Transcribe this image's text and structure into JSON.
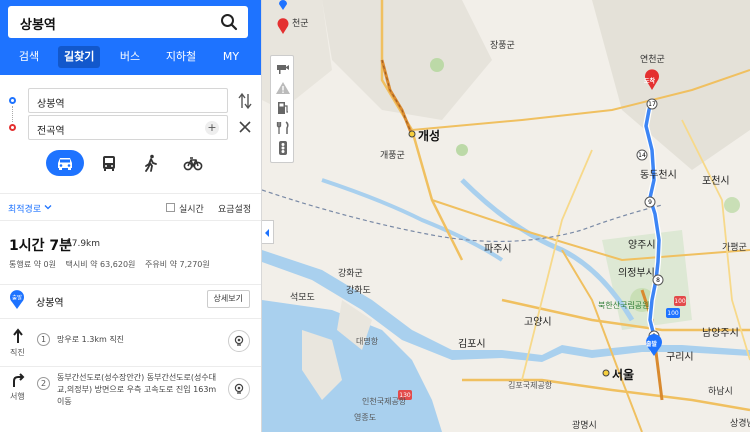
{
  "search": {
    "query": "상봉역"
  },
  "tabs": [
    "검색",
    "길찾기",
    "버스",
    "지하철",
    "MY"
  ],
  "route": {
    "start": "상봉역",
    "end": "전곡역"
  },
  "options": {
    "sort_label": "최적경로",
    "realtime_label": "실시간",
    "fee_setting_label": "요금설정"
  },
  "summary": {
    "time": "1시간 7분",
    "distance": "57.9km",
    "toll": "통행료 약 0원",
    "taxi": "택시비 약 63,620원",
    "fuel": "주유비 약 7,270원"
  },
  "steps": {
    "start_badge": "출발",
    "start_name": "상봉역",
    "detail_button": "상세보기",
    "s1_dir": "직진",
    "s1_num": "1",
    "s1_text": "망우로 1.3km 직진",
    "s2_dir": "서행",
    "s2_num": "2",
    "s2_text": "동부간선도로(성수장안간) 동부간선도로(성수대교,의정부) 방면으로 우측 고속도로 진입 163m 이동"
  },
  "map": {
    "labels": {
      "cheongun": "천군",
      "jangpung": "장풍군",
      "yeoncheon": "연천군",
      "gaeseong": "개성",
      "gaepung": "개풍군",
      "dongducheon": "동두천시",
      "pocheon": "포천시",
      "paju": "파주시",
      "yangju": "양주시",
      "gapyeong": "가평군",
      "gangwha": "강화군",
      "gangwhado": "강화도",
      "uijeongbu": "의정부시",
      "seokmodo": "석모도",
      "bukhansan": "북한산국립공원",
      "goyang": "고양시",
      "namyangju": "남양주시",
      "gimpo": "김포시",
      "guri": "구리시",
      "daemyeong": "대명항",
      "incheon_airport": "인천국제공항",
      "gimpo_airport": "김포국제공항",
      "seoul": "서울",
      "hanam": "하남시",
      "yeongjongdo": "영종도",
      "gwangmyeong": "광명시",
      "sanggyeongnam": "상경남",
      "dest_pin": "도착",
      "start_pin": "출발"
    },
    "route_color": "#3d85f5"
  },
  "colors": {
    "brand_blue": "#1e73ff",
    "end_red": "#e43030"
  }
}
